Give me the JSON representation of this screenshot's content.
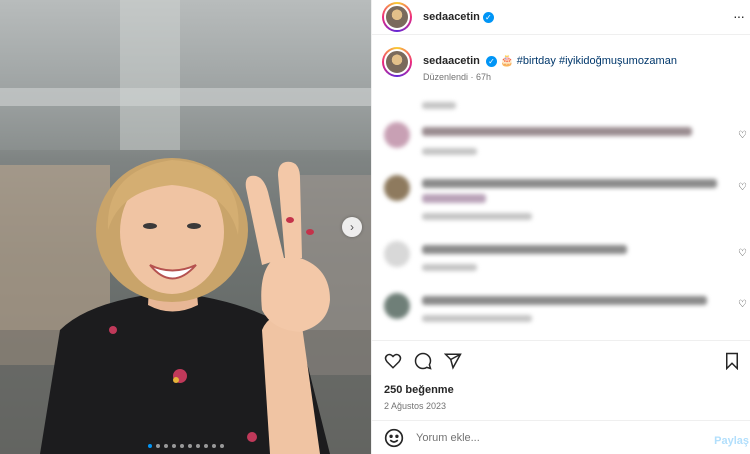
{
  "post": {
    "username": "sedaacetin",
    "caption_emoji": "🎂",
    "caption_hashtags": "#birtday #iyikidoğmuşumozaman",
    "edited_label": "Düzenlendi",
    "time_ago": "67h",
    "likes_label": "250 beğenme",
    "date_label": "2 Ağustos 2023",
    "comment_placeholder": "Yorum ekle...",
    "post_button": "Paylaş",
    "more_icon": "···",
    "verified_icon": "✓",
    "next_icon": "›"
  },
  "carousel": {
    "slide_count": 10,
    "active_index": 0
  },
  "icons": {
    "heart": "heart-icon",
    "comment": "comment-icon",
    "share": "share-icon",
    "save": "bookmark-icon",
    "emoji": "emoji-icon",
    "more": "more-icon"
  },
  "colors": {
    "accent": "#0095f6",
    "hashtag": "#00376b",
    "muted": "#737373",
    "post_disabled": "#b2dffc"
  }
}
